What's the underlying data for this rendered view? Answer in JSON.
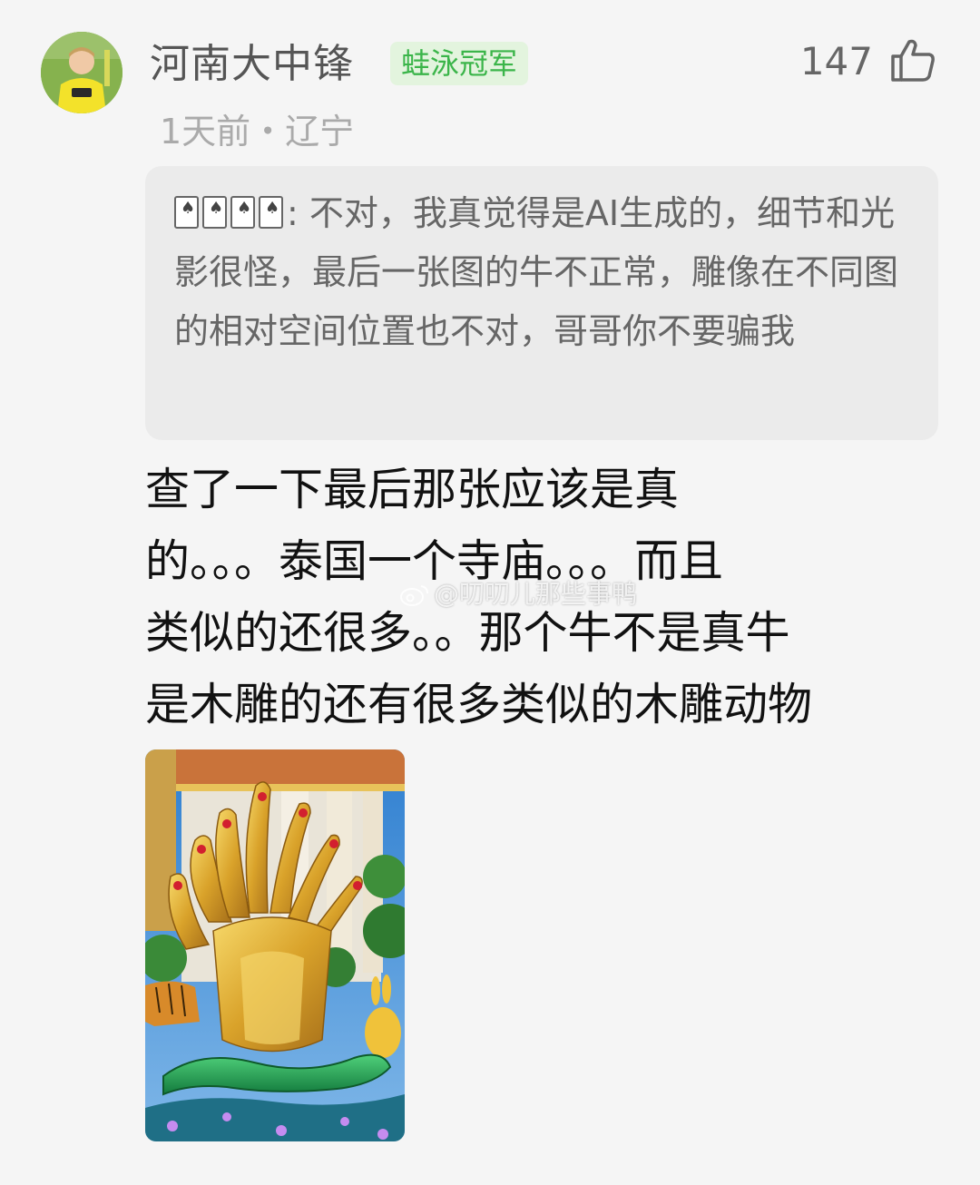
{
  "comment": {
    "author": "河南大中锋",
    "badge": "蛙泳冠军",
    "likes": "147",
    "time_location": "1天前・辽宁",
    "quoted": {
      "author_glyphs": "🂡🂡🂡🂡",
      "text": ": 不对，我真觉得是AI生成的，细节和光影很怪，最后一张图的牛不正常，雕像在不同图的相对空间位置也不对，哥哥你不要骗我"
    },
    "reply_lines": [
      "查了一下最后那张应该是真",
      "的。。。泰国一个寺庙。。。而且",
      "类似的还很多。。那个牛不是真牛",
      "是木雕的还有很多类似的木雕动物"
    ],
    "watermark": "@叨叨儿那些事鸭"
  },
  "icons": {
    "like": "thumbs-up-icon",
    "watermark": "weibo-icon"
  },
  "colors": {
    "badge_bg": "#e3f4de",
    "badge_text": "#3bb54a",
    "quote_bg": "#ebebeb"
  }
}
